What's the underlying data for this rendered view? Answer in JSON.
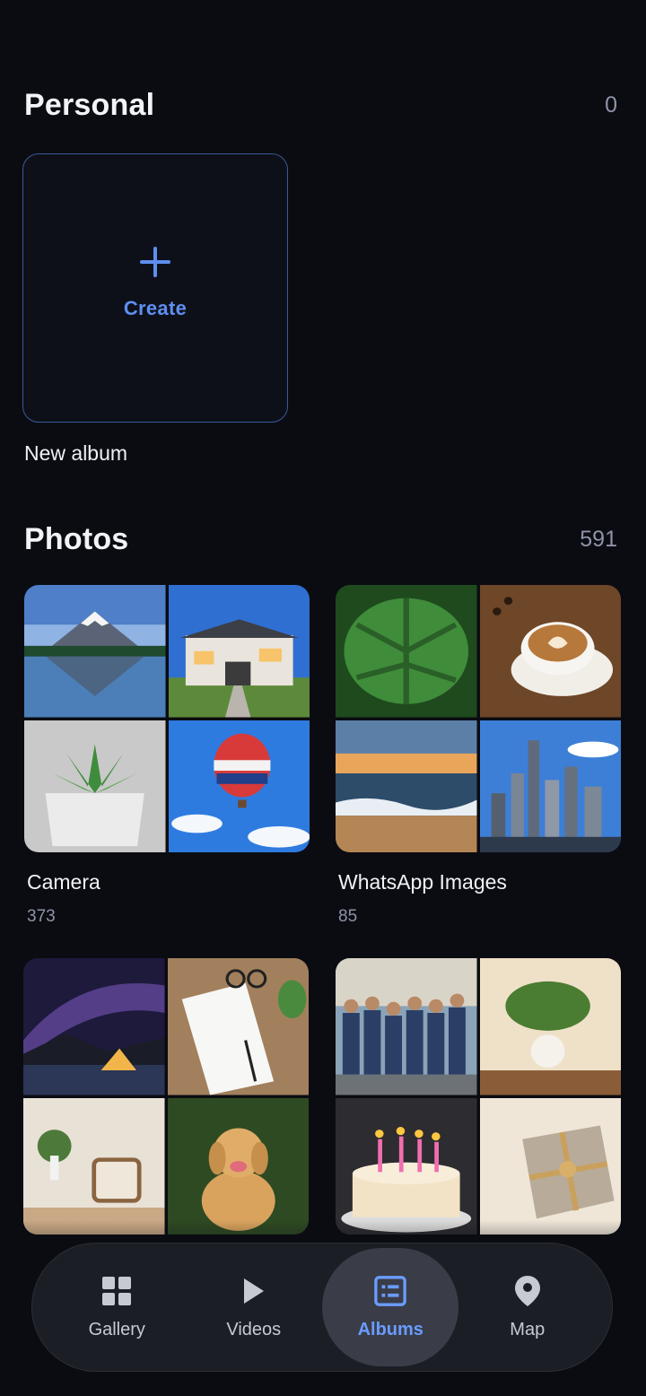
{
  "personal": {
    "title": "Personal",
    "count": "0",
    "create_label": "Create",
    "new_album_label": "New album"
  },
  "photos": {
    "title": "Photos",
    "count": "591",
    "albums": [
      {
        "name": "Camera",
        "count": "373"
      },
      {
        "name": "WhatsApp Images",
        "count": "85"
      },
      {
        "name": "",
        "count": ""
      },
      {
        "name": "",
        "count": ""
      }
    ]
  },
  "nav": {
    "items": [
      {
        "label": "Gallery",
        "icon": "grid-icon"
      },
      {
        "label": "Videos",
        "icon": "play-icon"
      },
      {
        "label": "Albums",
        "icon": "album-list-icon",
        "active": true
      },
      {
        "label": "Map",
        "icon": "location-pin-icon"
      }
    ]
  },
  "colors": {
    "background": "#0b0c12",
    "accent": "#5e8ff0",
    "nav_active": "#6a9cff"
  }
}
